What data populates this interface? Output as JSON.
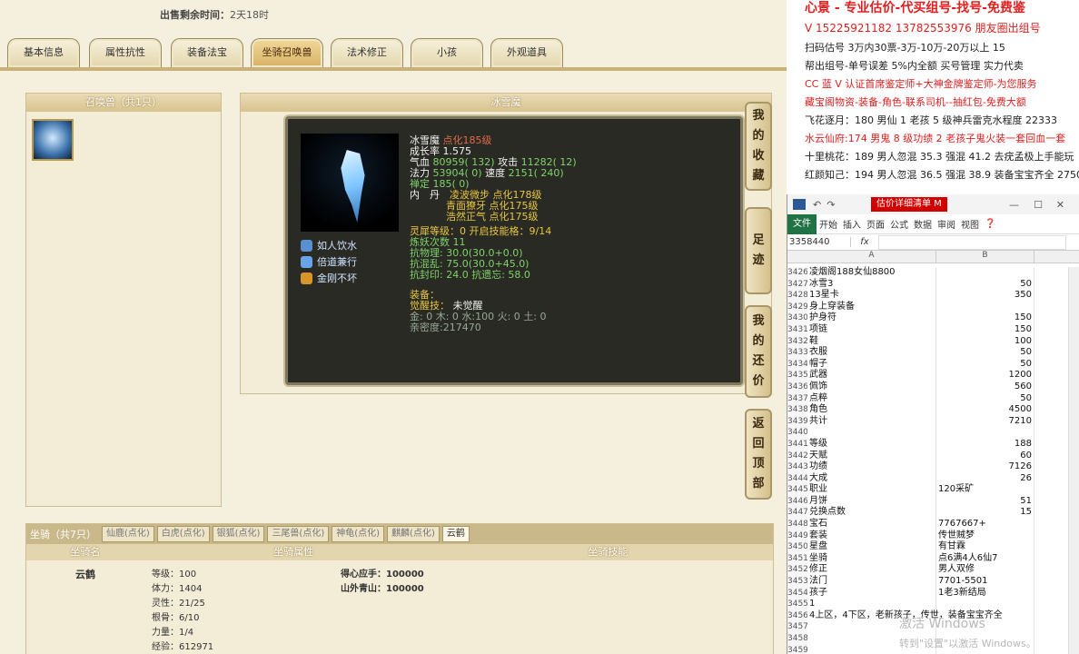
{
  "timer": {
    "label": "出售剩余时间：",
    "value": "2天18时"
  },
  "tabs": [
    "基本信息",
    "属性抗性",
    "装备法宝",
    "坐骑召唤兽",
    "法术修正",
    "小孩",
    "外观道具"
  ],
  "pet_list": {
    "title": "召唤兽（共1只）"
  },
  "pet_detail": {
    "title": "冰雪魔",
    "name": "冰雪魔",
    "name_extra": "点化185级",
    "growth": "成长率 1.575",
    "line_hp_label": "气血",
    "line_hp": "80959( 132)",
    "line_atk_label": "攻击",
    "line_atk": "11282( 12)",
    "line_mp_label": "法力",
    "line_mp": "53904( 0)",
    "line_spd_label": "速度",
    "line_spd": "2151( 240)",
    "line_zen": "禅定 185( 0)",
    "neidan_label": "内　丹",
    "neidan1": "凌波微步 点化178级",
    "neidan2": "青面獠牙 点化175级",
    "neidan3": "浩然正气 点化175级",
    "spirit": "灵犀等级：0 开启技能格：9/14",
    "lianyao": "炼妖次数 11",
    "kang1": "抗物理: 30.0(30.0+0.0)",
    "kang2": "抗混乱: 75.0(30.0+45.0)",
    "kang3": "抗封印: 24.0 抗遗忘: 58.0",
    "equip": "装备：",
    "awaken_label": "觉醒技：",
    "awaken_value": "未觉醒",
    "elements": "金: 0 木: 0 水:100 火: 0 土: 0",
    "intimacy": "亲密度:217470",
    "skills": [
      "如人饮水",
      "倍道兼行",
      "金刚不坏"
    ]
  },
  "side_buttons": [
    {
      "label": "我的收藏",
      "chars": [
        "我",
        "的",
        "收",
        "藏"
      ]
    },
    {
      "label": "足迹",
      "chars": [
        "足",
        "迹"
      ]
    },
    {
      "label": "我的还价",
      "chars": [
        "我",
        "的",
        "还",
        "价"
      ]
    },
    {
      "label": "返回顶部",
      "chars": [
        "返",
        "回",
        "顶",
        "部"
      ]
    }
  ],
  "mount": {
    "header_label": "坐骑（共7只）",
    "tabs": [
      "仙鹿(点化)",
      "白虎(点化)",
      "银狐(点化)",
      "三尾兽(点化)",
      "神龟(点化)",
      "麒麟(点化)",
      "云鹤"
    ],
    "col_name": "坐骑名",
    "col_attr": "坐骑属性",
    "col_skill": "坐骑技能",
    "name": "云鹤",
    "attrs": [
      "等级：100",
      "体力：1404",
      "灵性：21/25",
      "根骨：6/10",
      "力量：1/4",
      "经验：612971"
    ],
    "skills": [
      "得心应手：100000",
      "山外青山：100000"
    ]
  },
  "ads": [
    {
      "text": "心景 - 专业估价-代买组号-找号-免费鉴",
      "color": "#e02020"
    },
    {
      "text": "V 15225921182   13782553976 朋友圈出组号",
      "color": "#e02020"
    },
    {
      "text": "扫码估号 3万内30票-3万-10万-20万以上 15",
      "color": "#222"
    },
    {
      "text": "帮出组号-单号误差 5%内全额 买号管理 实力代卖",
      "color": "#222"
    },
    {
      "text": "CC 蓝 V 认证首席鉴定师+大神金牌鉴定师-为您服务",
      "color": "#e02020"
    },
    {
      "text": "藏宝阁物资-装备-角色-联系司机--抽红包-免费大额",
      "color": "#e02020"
    },
    {
      "text": "飞花逐月：180 男仙 1 老孩 5 级神兵雷克水程度 22333",
      "color": "#222"
    },
    {
      "text": "水云仙府:174 男鬼 8 级功绩 2 老孩子鬼火装一套回血一套",
      "color": "#e02020"
    },
    {
      "text": "十里桃花：189 男人忽混 35.3 强混 41.2 去疣孟极上手能玩",
      "color": "#222"
    },
    {
      "text": "红颜知己：194 男人忽混 36.5 强混 38.9 装备宝宝齐全 2750",
      "color": "#222"
    }
  ],
  "excel": {
    "title": "估价详细清单 M",
    "ribbon": [
      "文件",
      "开始",
      "插入",
      "页面",
      "公式",
      "数据",
      "审阅",
      "视图"
    ],
    "cell_ref": "3358440",
    "fx": "fx",
    "col_a": "A",
    "col_b": "B",
    "rows": [
      {
        "n": "3426",
        "a": "凌烟阁188女仙8800",
        "b": ""
      },
      {
        "n": "3427",
        "a": "冰雪3",
        "b": "50"
      },
      {
        "n": "3428",
        "a": "13星卡",
        "b": "350"
      },
      {
        "n": "3429",
        "a": "身上穿装备",
        "b": ""
      },
      {
        "n": "3430",
        "a": "护身符",
        "b": "150"
      },
      {
        "n": "3431",
        "a": "项链",
        "b": "150"
      },
      {
        "n": "3432",
        "a": "鞋",
        "b": "100"
      },
      {
        "n": "3433",
        "a": "衣服",
        "b": "50"
      },
      {
        "n": "3434",
        "a": "帽子",
        "b": "50"
      },
      {
        "n": "3435",
        "a": "武器",
        "b": "1200"
      },
      {
        "n": "3436",
        "a": "佩饰",
        "b": "560"
      },
      {
        "n": "3437",
        "a": "点粹",
        "b": "50"
      },
      {
        "n": "3438",
        "a": "角色",
        "b": "4500"
      },
      {
        "n": "3439",
        "a": "共计",
        "b": "7210"
      },
      {
        "n": "3440",
        "a": "",
        "b": ""
      },
      {
        "n": "3441",
        "a": "等级",
        "b": "188"
      },
      {
        "n": "3442",
        "a": "天赋",
        "b": "60"
      },
      {
        "n": "3443",
        "a": "功绩",
        "b": "7126"
      },
      {
        "n": "3444",
        "a": "大成",
        "b": "26"
      },
      {
        "n": "3445",
        "a": "职业",
        "b": "120采矿",
        "bl": true
      },
      {
        "n": "3446",
        "a": "月饼",
        "b": "51"
      },
      {
        "n": "3447",
        "a": "兑换点数",
        "b": "15"
      },
      {
        "n": "3448",
        "a": "宝石",
        "b": "7767667+",
        "bl": true
      },
      {
        "n": "3449",
        "a": "套装",
        "b": "传世贼梦",
        "bl": true
      },
      {
        "n": "3450",
        "a": "星盘",
        "b": "有甘霖",
        "bl": true
      },
      {
        "n": "3451",
        "a": "坐骑",
        "b": "点6满4人6仙7",
        "bl": true
      },
      {
        "n": "3452",
        "a": "修正",
        "b": "男人双修",
        "bl": true
      },
      {
        "n": "3453",
        "a": "法门",
        "b": "7701-5501",
        "bl": true
      },
      {
        "n": "3454",
        "a": "孩子",
        "b": "1老3新结局",
        "bl": true
      },
      {
        "n": "3455",
        "a": "1",
        "b": ""
      },
      {
        "n": "3456",
        "a": "4上区，4下区，老新孩子，传世，装备宝宝齐全",
        "b": ""
      },
      {
        "n": "3457",
        "a": "",
        "b": ""
      },
      {
        "n": "3458",
        "a": "",
        "b": ""
      },
      {
        "n": "3459",
        "a": "",
        "b": ""
      }
    ],
    "watermark": "激活 Windows",
    "watermark_sub": "转到\"设置\"以激活 Windows。"
  }
}
